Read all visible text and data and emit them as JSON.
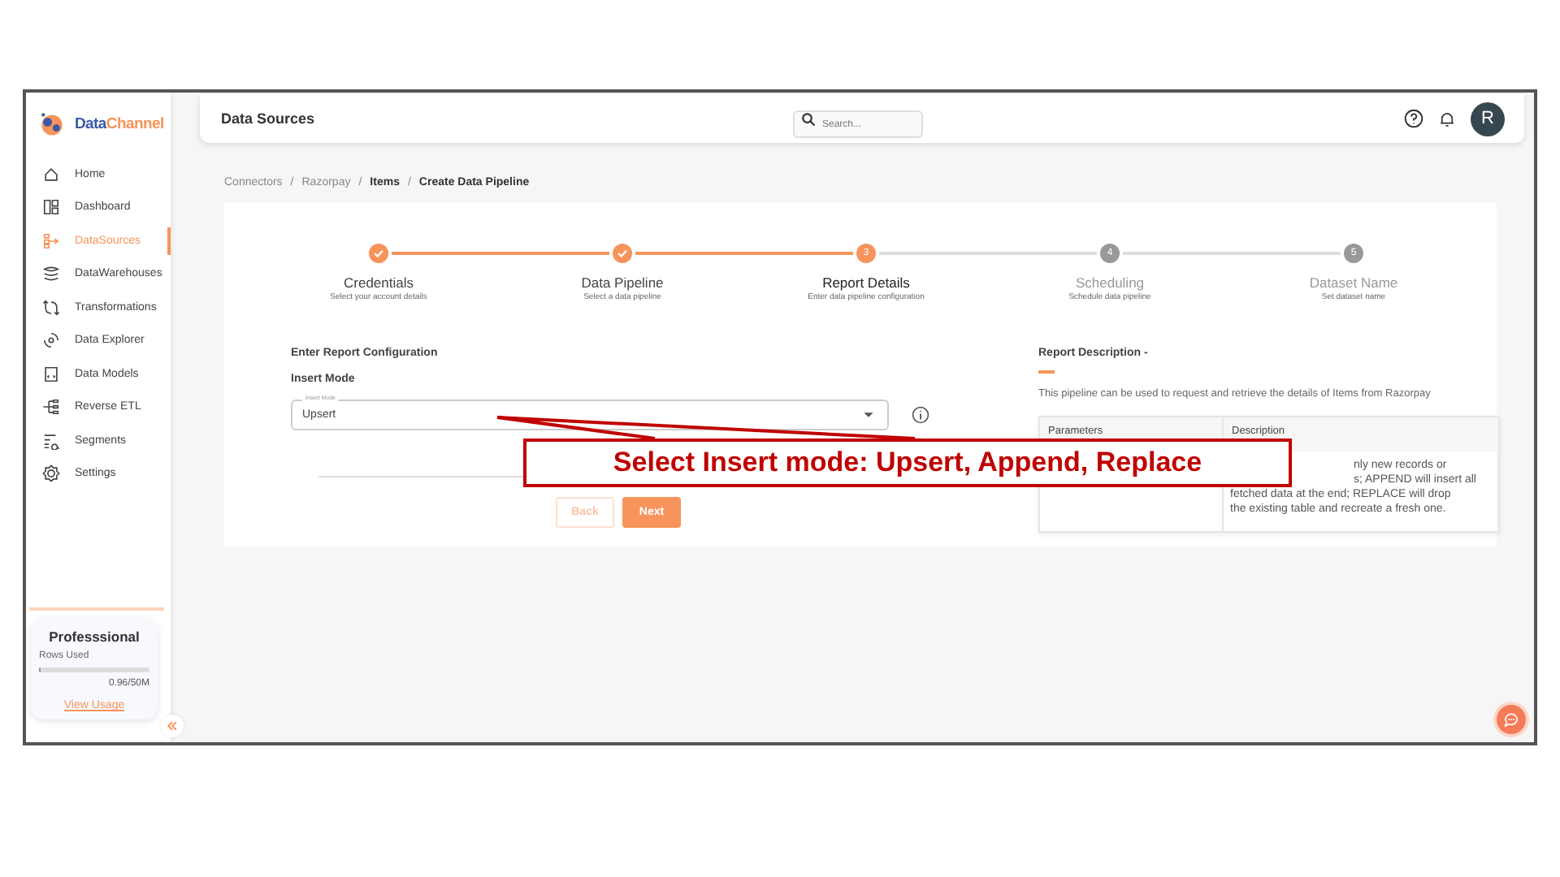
{
  "sidebar": {
    "logo": {
      "prefix": "Data",
      "suffix": "Channel"
    },
    "items": [
      {
        "label": "Home",
        "selected": false
      },
      {
        "label": "Dashboard",
        "selected": false
      },
      {
        "label": "DataSources",
        "selected": true
      },
      {
        "label": "DataWarehouses",
        "selected": false
      },
      {
        "label": "Transformations",
        "selected": false
      },
      {
        "label": "Data Explorer",
        "selected": false
      },
      {
        "label": "Data Models",
        "selected": false
      },
      {
        "label": "Reverse ETL",
        "selected": false
      },
      {
        "label": "Segments",
        "selected": false
      },
      {
        "label": "Settings",
        "selected": false
      }
    ],
    "plan": {
      "name": "Professsional",
      "usage_label": "Rows Used",
      "level": 0.02,
      "reading": "0.96/50M",
      "link": "View Usage"
    }
  },
  "topbar": {
    "title": "Data Sources",
    "search": {
      "placeholder": "Search..."
    },
    "avatar": "R"
  },
  "breadcrumb": {
    "separator": "/",
    "items": [
      {
        "label": "Connectors",
        "bold": false
      },
      {
        "label": "Razorpay",
        "bold": false
      },
      {
        "label": "Items",
        "bold": true
      },
      {
        "label": "Create Data Pipeline",
        "bold": true
      }
    ]
  },
  "steps": [
    {
      "title": "Credentials",
      "subtitle": "Select your account details",
      "completed": true,
      "selected": false
    },
    {
      "title": "Data Pipeline",
      "subtitle": "Select a data pipeline",
      "completed": true,
      "selected": false
    },
    {
      "number": "3",
      "title": "Report Details",
      "subtitle": "Enter data pipeline configuration",
      "completed": false,
      "selected": true
    },
    {
      "number": "4",
      "title": "Scheduling",
      "subtitle": "Schedule data pipeline",
      "completed": false,
      "selected": false
    },
    {
      "number": "5",
      "title": "Dataset Name",
      "subtitle": "Set dataset name",
      "completed": false,
      "selected": false
    }
  ],
  "form": {
    "heading": "Enter Report Configuration",
    "field_label": "Insert Mode",
    "select": {
      "floating_label": "Insert Mode",
      "value": "Upsert"
    },
    "buttons": [
      {
        "label": "Back",
        "kind": "secondary"
      },
      {
        "label": "Next",
        "kind": "primary"
      }
    ]
  },
  "description": {
    "heading": "Report Description -",
    "text": "This pipeline can be used to request and retrieve the details of Items from Razorpay",
    "table": {
      "columns": [
        "Parameters",
        "Description"
      ],
      "description_lines": [
        {
          "text": "nly new records or",
          "kind": "cut"
        },
        {
          "text": "s; APPEND will insert all",
          "kind": "cut"
        },
        {
          "text": "fetched data at the end; REPLACE will drop",
          "kind": "full"
        },
        {
          "text": "the existing table and recreate a fresh one.",
          "kind": "full"
        }
      ]
    }
  },
  "callout": "Select Insert mode: Upsert, Append, Replace"
}
